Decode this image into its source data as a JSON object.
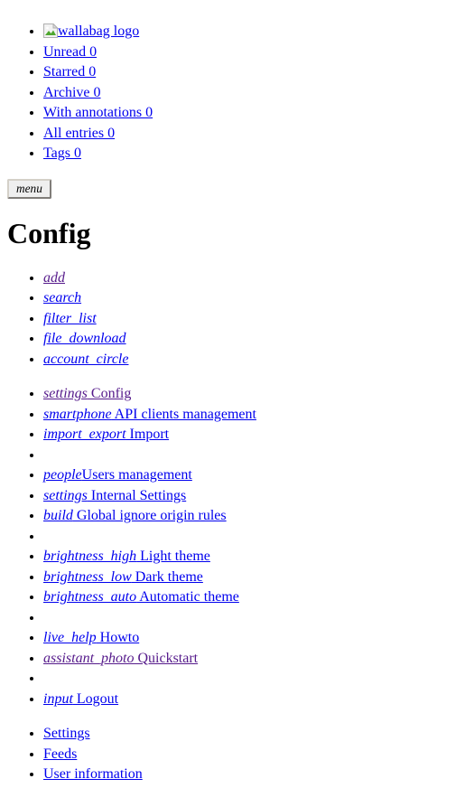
{
  "document": {
    "title": "Config"
  },
  "top_nav": {
    "items": [
      {
        "label": "wallabag logo",
        "icon": "broken-image-icon",
        "state": "unvisited",
        "has_icon": true
      },
      {
        "label": "Unread 0",
        "state": "unvisited",
        "has_icon": false
      },
      {
        "label": "Starred 0",
        "state": "unvisited",
        "has_icon": false
      },
      {
        "label": "Archive 0",
        "state": "unvisited",
        "has_icon": false
      },
      {
        "label": "With annotations 0",
        "state": "unvisited",
        "has_icon": false
      },
      {
        "label": "All entries 0",
        "state": "unvisited",
        "has_icon": false
      },
      {
        "label": "Tags 0",
        "state": "unvisited",
        "has_icon": false
      }
    ]
  },
  "menu_button": {
    "label": "menu"
  },
  "heading": {
    "text": "Config"
  },
  "action_icons": {
    "items": [
      {
        "icon_name": "add",
        "state": "visited"
      },
      {
        "icon_name": "search",
        "state": "unvisited"
      },
      {
        "icon_name": "filter_list",
        "state": "unvisited"
      },
      {
        "icon_name": "file_download",
        "state": "unvisited"
      },
      {
        "icon_name": "account_circle",
        "state": "unvisited"
      }
    ]
  },
  "main_menu": {
    "groups": [
      {
        "items": [
          {
            "icon_name": "settings",
            "label": " Config",
            "state": "visited",
            "divider": false
          },
          {
            "icon_name": "smartphone",
            "label": " API clients management",
            "state": "unvisited",
            "divider": false
          },
          {
            "icon_name": "import_export",
            "label": " Import",
            "state": "unvisited",
            "divider": false
          },
          {
            "divider": true
          },
          {
            "icon_name": "people",
            "label": "Users management",
            "state": "unvisited",
            "divider": false
          },
          {
            "icon_name": "settings",
            "label": " Internal Settings",
            "state": "unvisited",
            "divider": false
          },
          {
            "icon_name": "build",
            "label": " Global ignore origin rules",
            "state": "unvisited",
            "divider": false
          },
          {
            "divider": true
          },
          {
            "icon_name": "brightness_high",
            "label": " Light theme",
            "state": "unvisited",
            "divider": false
          },
          {
            "icon_name": "brightness_low",
            "label": " Dark theme",
            "state": "unvisited",
            "divider": false
          },
          {
            "icon_name": "brightness_auto",
            "label": " Automatic theme",
            "state": "unvisited",
            "divider": false
          },
          {
            "divider": true
          },
          {
            "icon_name": "live_help",
            "label": " Howto",
            "state": "unvisited",
            "divider": false
          },
          {
            "icon_name": "assistant_photo",
            "label": " Quickstart",
            "state": "visited",
            "divider": false
          },
          {
            "divider": true
          },
          {
            "icon_name": "input",
            "label": " Logout",
            "state": "unvisited",
            "divider": false
          }
        ]
      }
    ]
  },
  "config_tabs": {
    "items": [
      {
        "label": "Settings",
        "state": "unvisited"
      },
      {
        "label": "Feeds",
        "state": "unvisited"
      },
      {
        "label": "User information",
        "state": "unvisited"
      }
    ]
  }
}
